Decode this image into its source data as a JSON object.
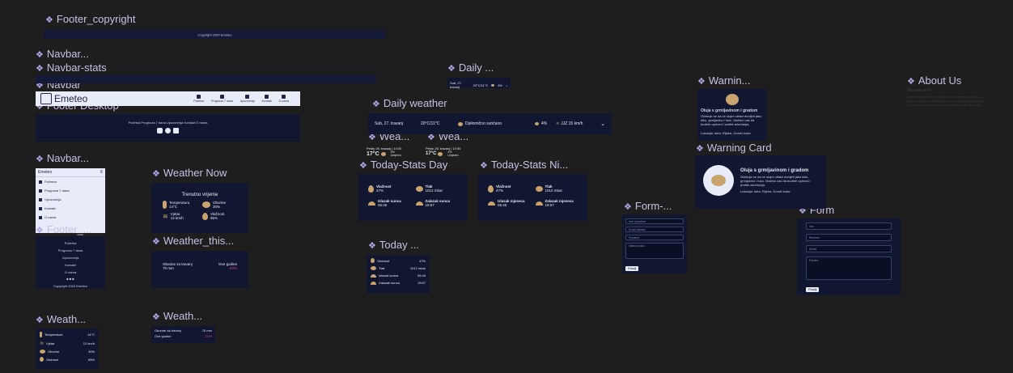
{
  "labels": {
    "footer_copyright": "Footer_copyright",
    "navbar1": "Navbar...",
    "navbar_stats": "Navbar-stats",
    "navbar": "Navbar",
    "footer_desktop": "Footer Desktop",
    "navbar2": "Navbar...",
    "navbar_hidden": "Navbar...",
    "footer2": "Footer_...",
    "weather_now": "Weather Now",
    "weather_this": "Weather_this...",
    "weath1": "Weath...",
    "weath2": "Weath...",
    "daily_small": "Daily ...",
    "daily_weather": "Daily weather",
    "wea1": "Wea...",
    "wea2": "Wea...",
    "today_stats_day": "Today-Stats Day",
    "today_stats_night": "Today-Stats Ni...",
    "today_small": "Today ...",
    "warning_small": "Warnin...",
    "warning_card": "Warning Card",
    "form_small": "Form-...",
    "form": "Form",
    "about_us": "About Us"
  },
  "footer_copyright": {
    "text": "Copyright 2024 Emeteo"
  },
  "navbar": {
    "brand": "Emeteo",
    "items": [
      "Početna",
      "Prognoza 7 dana",
      "Upozorenja",
      "Kontakt",
      "O nama"
    ]
  },
  "footer_desktop": {
    "links": "Početna  Prognoza 7 dana  Upozorenja  Kontakt  O nama"
  },
  "mobile_nav": {
    "brand": "Emeteo",
    "items": [
      "Početna",
      "Prognoza 7 dana",
      "Upozorenja",
      "Kontakt",
      "O nama"
    ]
  },
  "mobile_footer": {
    "items": [
      "Početna",
      "Prognoza 7 dana",
      "Upozorenja",
      "Kontakt",
      "O nama"
    ],
    "copyright": "Copyright 2024 Emeteo"
  },
  "weather_now": {
    "title": "Trenutno vrijeme",
    "temp_label": "Temperatura",
    "temp_value": "14°C",
    "rain_label": "Oborine",
    "rain_value": "30%",
    "wind_label": "Vjetar",
    "wind_value": "12 km/h",
    "hum_label": "Vlažnost",
    "hum_value": "65%"
  },
  "weather_this": {
    "left1": "Oborine za travanj",
    "left2": "70 mm",
    "right1": "Ove godine",
    "right2": "-20%"
  },
  "weath_list": {
    "rows": [
      {
        "label": "Temperatura",
        "value": "14°C"
      },
      {
        "label": "Vjetar",
        "value": "12 km/h"
      },
      {
        "label": "Oborine",
        "value": "30%"
      },
      {
        "label": "Vlažnost",
        "value": "65%"
      }
    ]
  },
  "weath_rain": {
    "left1": "Oborine za travanj",
    "left1_value": "70 mm",
    "left2": "Ove godine",
    "left2_value": "-20%"
  },
  "daily_small": {
    "day": "Sub, 27. travanj",
    "temp": "20°C/11°C",
    "rain": "4%"
  },
  "daily_weather": {
    "day": "Sub, 27. travanj",
    "temp": "20°C/11°C",
    "desc": "Djelomično sunčano",
    "rain": "4%",
    "wind": "JJZ 15 km/h"
  },
  "wea1": {
    "date": "Petak 26. travanj | 13:00",
    "temp": "17°C",
    "rain": "4%",
    "wind": "Umjeren"
  },
  "wea2": {
    "date": "Petak 26. travanj | 13:00",
    "temp": "17°C",
    "rain": "4%",
    "wind": "Umjeren"
  },
  "today_day": {
    "hum_label": "Vlažnost",
    "hum_value": "47%",
    "press_label": "Tlak",
    "press_value": "1012 mbar",
    "sunrise_label": "Izlazak sunca",
    "sunrise_value": "05:45",
    "sunset_label": "Zalazak sunca",
    "sunset_value": "19:57"
  },
  "today_night": {
    "hum_label": "Vlažnost",
    "hum_value": "47%",
    "press_label": "Tlak",
    "press_value": "1012 mbar",
    "moonrise_label": "Izlazak mjeseca",
    "moonrise_value": "05:45",
    "moonset_label": "Zalazak mjeseca",
    "moonset_value": "19:57"
  },
  "today_list": {
    "rows": [
      {
        "label": "Vlažnost",
        "value": "47%"
      },
      {
        "label": "Tlak",
        "value": "1012 mbar"
      },
      {
        "label": "Izlazak sunca",
        "value": "05:45"
      },
      {
        "label": "Zalazak sunca",
        "value": "19:57"
      }
    ]
  },
  "warning": {
    "title": "Oluja s grmljavinom i gradom",
    "body": "Očekuje se da će olujni oblaci donijeti jaku kišu, grmljavinu i tuču. Molimo vas da budete oprezni i pratite ažuriranja.",
    "meta": "Lokacija: Istra, Rijeka, Gorski kotar"
  },
  "form_small": {
    "fields": [
      "Ime i prezime",
      "Email adresa",
      "Predmet",
      "Vaša poruka"
    ],
    "button": "Pošalji"
  },
  "form": {
    "fields": [
      "Ime",
      "Prezime",
      "Email",
      "Poruka"
    ],
    "button": "Pošalji"
  },
  "about": {
    "subtitle": "Tko smo mi?",
    "body": "Emeteo je vodeća platforma za vremensku prognozu. Naša misija je pružiti točne i pravovremene informacije o vremenu kako biste mogli planirati svoje aktivnosti."
  }
}
